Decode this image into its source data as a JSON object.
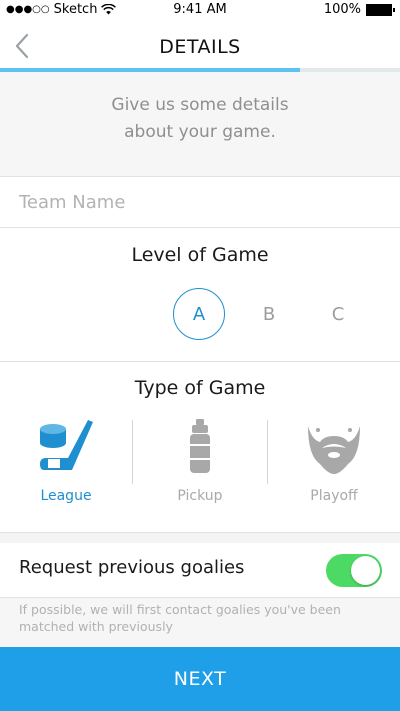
{
  "status_bar": {
    "carrier": "Sketch",
    "time": "9:41 AM",
    "battery": "100%"
  },
  "nav": {
    "title": "DETAILS",
    "progress": 0.75
  },
  "intro": {
    "line1": "Give us some details",
    "line2": "about your game."
  },
  "team": {
    "placeholder": "Team Name",
    "value": ""
  },
  "level": {
    "title": "Level of Game",
    "options": [
      "A",
      "B",
      "C"
    ],
    "selected": "A"
  },
  "game_type": {
    "title": "Type of Game",
    "options": [
      {
        "label": "League",
        "icon": "hockey-stick-puck-icon"
      },
      {
        "label": "Pickup",
        "icon": "water-bottle-icon"
      },
      {
        "label": "Playoff",
        "icon": "beard-icon"
      }
    ],
    "selected": "League"
  },
  "goalies": {
    "label": "Request previous goalies",
    "enabled": true,
    "note": "If possible, we will first contact goalies you've been matched with previously"
  },
  "next_button": "NEXT",
  "colors": {
    "accent": "#1f8fcf",
    "button": "#1e9fe8",
    "progress": "#5cc2f2",
    "toggle_on": "#4cd964"
  }
}
